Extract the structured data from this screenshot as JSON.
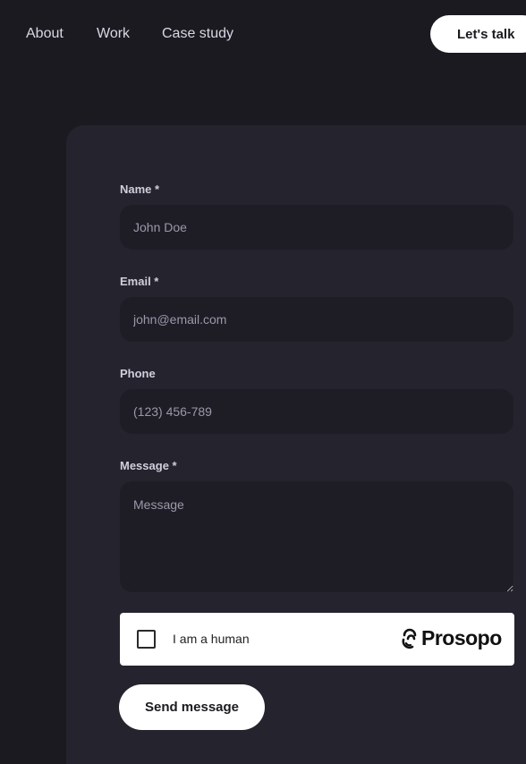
{
  "nav": {
    "links": [
      "About",
      "Work",
      "Case study"
    ],
    "cta_label": "Let's talk"
  },
  "form": {
    "name": {
      "label": "Name *",
      "placeholder": "John Doe"
    },
    "email": {
      "label": "Email *",
      "placeholder": "john@email.com"
    },
    "phone": {
      "label": "Phone",
      "placeholder": "(123) 456-789"
    },
    "message": {
      "label": "Message *",
      "placeholder": "Message"
    },
    "captcha": {
      "text": "I am a human",
      "brand": "Prosopo",
      "checked": false
    },
    "submit_label": "Send message"
  },
  "colors": {
    "background": "#1b1a20",
    "card": "#25232d",
    "field": "#1e1d25",
    "button": "#ffffff"
  }
}
